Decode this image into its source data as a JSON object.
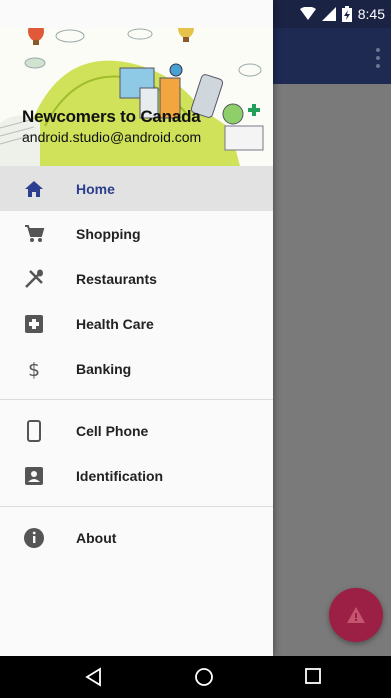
{
  "status_bar": {
    "time": "8:45"
  },
  "drawer": {
    "header": {
      "title": "Newcomers to Canada",
      "subtitle": "android.studio@android.com"
    },
    "sections": [
      [
        {
          "label": "Home",
          "icon": "home-icon",
          "active": true
        },
        {
          "label": "Shopping",
          "icon": "shopping-cart-icon"
        },
        {
          "label": "Restaurants",
          "icon": "restaurant-icon"
        },
        {
          "label": "Health Care",
          "icon": "health-care-icon"
        },
        {
          "label": "Banking",
          "icon": "dollar-icon"
        }
      ],
      [
        {
          "label": "Cell Phone",
          "icon": "cell-phone-icon"
        },
        {
          "label": "Identification",
          "icon": "id-card-icon"
        }
      ],
      [
        {
          "label": "About",
          "icon": "info-icon"
        }
      ]
    ]
  },
  "colors": {
    "accent": "#2c3f8f",
    "fab": "#9c1f45",
    "toolbar": "#1e2a52"
  }
}
